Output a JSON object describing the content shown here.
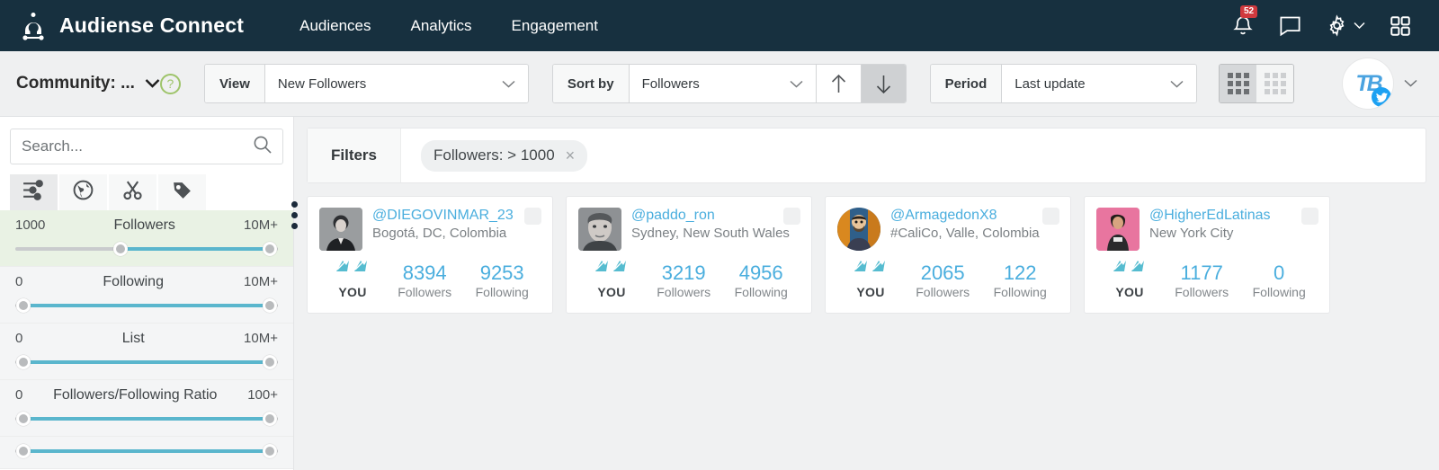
{
  "navbar": {
    "brand": "Audiense Connect",
    "links": [
      {
        "label": "Audiences"
      },
      {
        "label": "Analytics"
      },
      {
        "label": "Engagement"
      }
    ],
    "notifications_count": "52",
    "icons": [
      "bell-icon",
      "chat-icon",
      "gear-icon",
      "apps-grid-icon"
    ],
    "background_color": "#17303f"
  },
  "toolbar": {
    "community_label": "Community: ...",
    "help_icon": "?",
    "view": {
      "label": "View",
      "value": "New Followers"
    },
    "sort": {
      "label": "Sort by",
      "value": "Followers",
      "asc_icon": "↑",
      "desc_icon": "↓",
      "active_direction": "desc"
    },
    "period": {
      "label": "Period",
      "value": "Last update"
    },
    "view_toggle": {
      "active": "large-grid",
      "options": [
        "large-grid",
        "small-grid"
      ]
    },
    "account_avatar_initials": "TB",
    "account_network": "twitter"
  },
  "sidebar": {
    "search_placeholder": "Search...",
    "search_value": "",
    "tabs": [
      {
        "icon": "sliders-icon",
        "active": true
      },
      {
        "icon": "globe-icon",
        "active": false
      },
      {
        "icon": "scissors-icon",
        "active": false
      },
      {
        "icon": "tag-icon",
        "active": false
      }
    ],
    "sliders": [
      {
        "name": "Followers",
        "min": "1000",
        "max": "10M+",
        "fill_start_pct": 40,
        "fill_end_pct": 97,
        "highlight": true
      },
      {
        "name": "Following",
        "min": "0",
        "max": "10M+",
        "fill_start_pct": 3,
        "fill_end_pct": 97,
        "highlight": false
      },
      {
        "name": "List",
        "min": "0",
        "max": "10M+",
        "fill_start_pct": 3,
        "fill_end_pct": 97,
        "highlight": false
      },
      {
        "name": "Followers/Following Ratio",
        "min": "0",
        "max": "100+",
        "fill_start_pct": 3,
        "fill_end_pct": 97,
        "highlight": false
      },
      {
        "name": "",
        "min": "",
        "max": "",
        "fill_start_pct": 3,
        "fill_end_pct": 97,
        "highlight": false
      }
    ]
  },
  "filters": {
    "label": "Filters",
    "chips": [
      {
        "text": "Followers: > 1000",
        "remove_icon": "×"
      }
    ]
  },
  "cards": [
    {
      "handle": "@DIEGOVINMAR_23",
      "location": "Bogotá, DC, Colombia",
      "relationship": "YOU",
      "followers_value": "8394",
      "followers_label": "Followers",
      "following_value": "9253",
      "following_label": "Following",
      "avatar_shape": "square"
    },
    {
      "handle": "@paddo_ron",
      "location": "Sydney, New South Wales",
      "relationship": "YOU",
      "followers_value": "3219",
      "followers_label": "Followers",
      "following_value": "4956",
      "following_label": "Following",
      "avatar_shape": "square"
    },
    {
      "handle": "@ArmagedonX8",
      "location": "#CaliCo, Valle, Colombia",
      "relationship": "YOU",
      "followers_value": "2065",
      "followers_label": "Followers",
      "following_value": "122",
      "following_label": "Following",
      "avatar_shape": "round"
    },
    {
      "handle": "@HigherEdLatinas",
      "location": "New York City",
      "relationship": "YOU",
      "followers_value": "1177",
      "followers_label": "Followers",
      "following_value": "0",
      "following_label": "Following",
      "avatar_shape": "square"
    }
  ],
  "colors": {
    "navbar": "#17303f",
    "link_blue": "#4aaede",
    "slider_fill": "#5ab6cd",
    "highlight_green": "#e9f2e4",
    "badge_red": "#d0393e"
  }
}
